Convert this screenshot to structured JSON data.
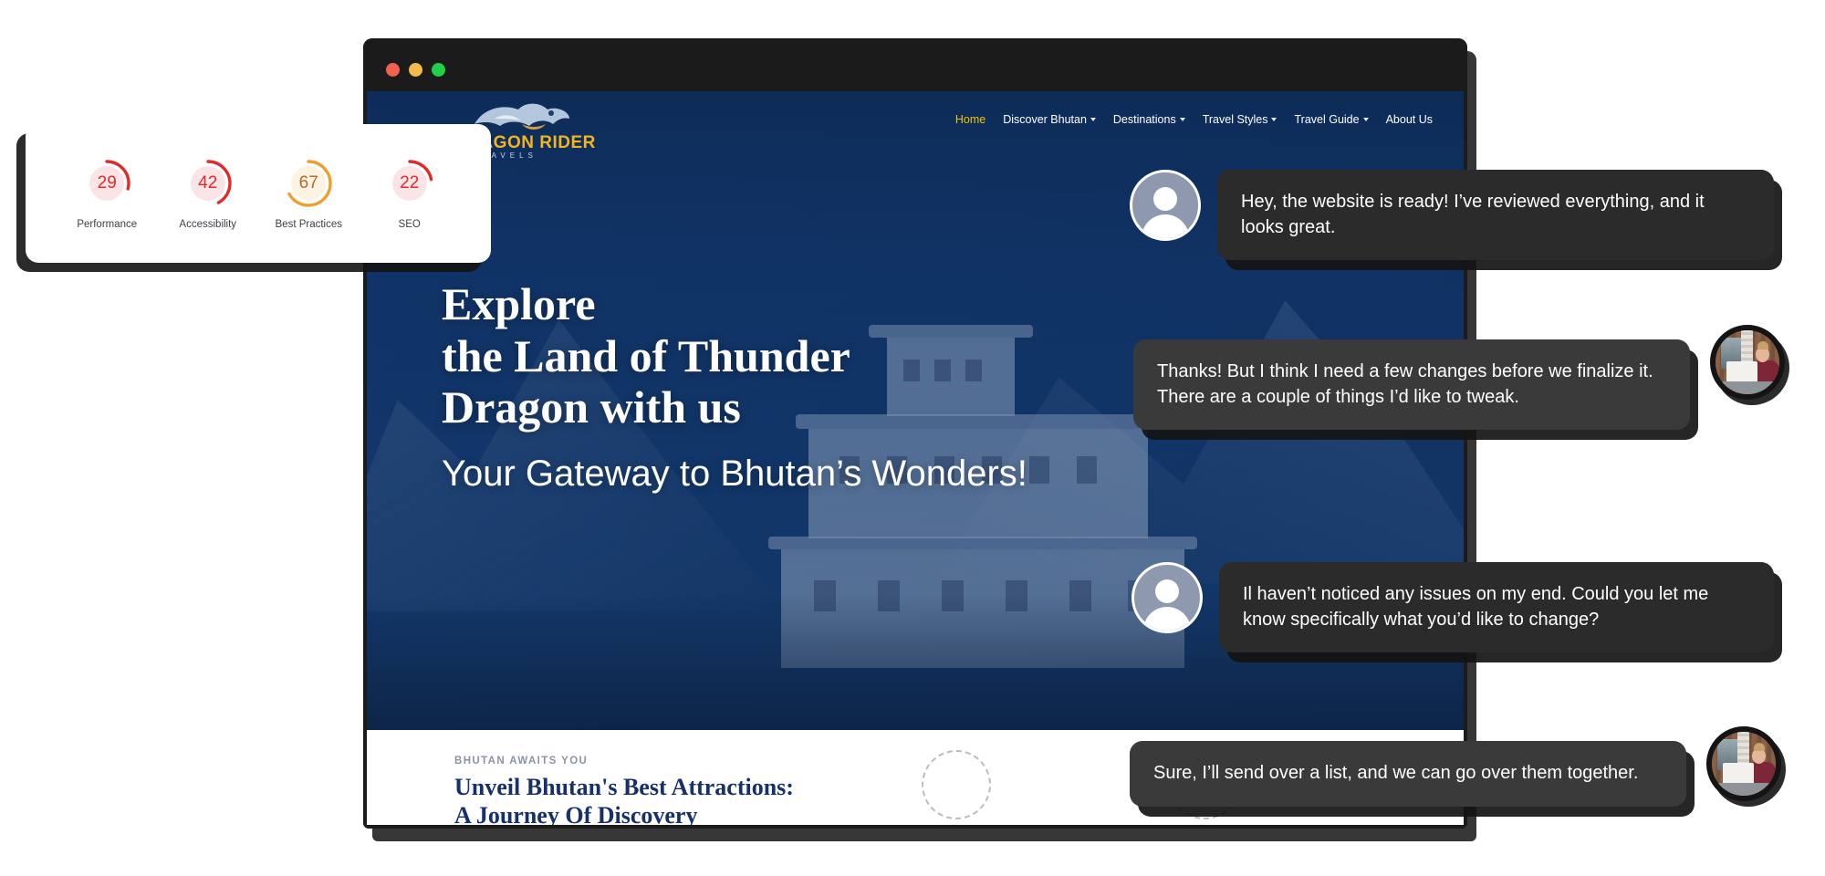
{
  "browser": {
    "window_controls": [
      "close-red",
      "minimize-yellow",
      "maximize-green"
    ]
  },
  "site": {
    "logo": {
      "wordmark": "DRAGON RIDER",
      "subword": "TRAVELS",
      "icon": "dragon-icon"
    },
    "nav": [
      {
        "label": "Home",
        "active": true,
        "has_dropdown": false
      },
      {
        "label": "Discover Bhutan",
        "active": false,
        "has_dropdown": true
      },
      {
        "label": "Destinations",
        "active": false,
        "has_dropdown": true
      },
      {
        "label": "Travel Styles",
        "active": false,
        "has_dropdown": true
      },
      {
        "label": "Travel Guide",
        "active": false,
        "has_dropdown": true
      },
      {
        "label": "About Us",
        "active": false,
        "has_dropdown": false
      }
    ],
    "hero": {
      "title_line_1": "Explore",
      "title_line_2": "the Land of Thunder",
      "title_line_3": "Dragon with us",
      "subtitle": "Your Gateway to Bhutan’s Wonders!"
    },
    "section": {
      "eyebrow": "BHUTAN AWAITS YOU",
      "title_line_1": "Unveil Bhutan's Best Attractions:",
      "title_line_2": "A Journey Of Discovery"
    },
    "colors": {
      "brand_navy": "#16306b",
      "brand_yellow": "#f2c200",
      "hero_overlay": "#0d2a54"
    }
  },
  "lighthouse": {
    "scores": [
      {
        "value": "29",
        "label": "Performance",
        "color": "#e32a2a",
        "track": "#fbe4e6",
        "percent": 29
      },
      {
        "value": "42",
        "label": "Accessibility",
        "color": "#e32a2a",
        "track": "#fbe4e6",
        "percent": 42
      },
      {
        "value": "67",
        "label": "Best Practices",
        "color": "#f0a02a",
        "track": "#fdf3e2",
        "percent": 67
      },
      {
        "value": "22",
        "label": "SEO",
        "color": "#e32a2a",
        "track": "#fbe4e6",
        "percent": 22
      }
    ]
  },
  "chat": {
    "messages": [
      {
        "id": "msg-1",
        "sender": "developer",
        "avatar": "person-placeholder-avatar",
        "avatar_side": "left",
        "text": "Hey, the website is ready! I’ve reviewed everything, and it looks great."
      },
      {
        "id": "msg-2",
        "sender": "client",
        "avatar": "woman-with-laptop-photo",
        "avatar_side": "right",
        "text": "Thanks! But I think I need a few changes before we finalize it. There are a couple of things I’d like to tweak."
      },
      {
        "id": "msg-3",
        "sender": "developer",
        "avatar": "person-placeholder-avatar",
        "avatar_side": "left",
        "text": "Il haven’t noticed any issues on my end. Could you let me know specifically what you’d like to change?"
      },
      {
        "id": "msg-4",
        "sender": "client",
        "avatar": "woman-with-laptop-photo",
        "avatar_side": "right",
        "text": "Sure, I’ll send over a list, and we can go over them together."
      }
    ]
  }
}
